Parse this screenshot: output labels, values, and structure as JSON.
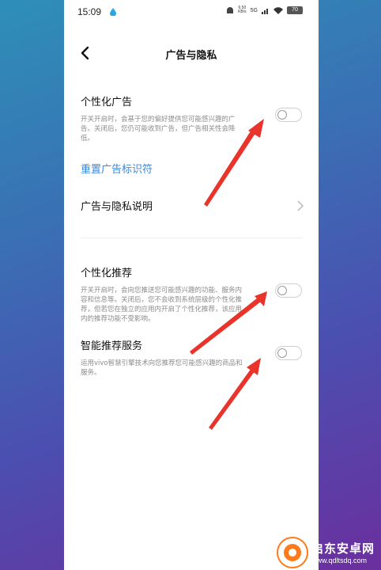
{
  "status_bar": {
    "time": "15:09",
    "net_speed_value": "6.50",
    "net_speed_unit": "KB/s",
    "signal_label": "5G",
    "battery": "70"
  },
  "header": {
    "title": "广告与隐私"
  },
  "settings": [
    {
      "title": "个性化广告",
      "description": "开关开启时，会基于您的偏好提供您可能感兴趣的广告。关闭后，您仍可能收到广告，但广告相关性会降低。",
      "enabled": false
    },
    {
      "title": "个性化推荐",
      "description": "开关开启时，会向您推送您可能感兴趣的功能、服务内容和信息等。关闭后，您不会收到系统层级的个性化推荐，但若您在独立的应用内开启了个性化推荐，该应用内的推荐功能不受影响。",
      "enabled": false
    },
    {
      "title": "智能推荐服务",
      "description": "运用vivo智慧引擎技术向您推荐您可能感兴趣的商品和服务。",
      "enabled": false
    }
  ],
  "reset_link": "重置广告标识符",
  "privacy_row": "广告与隐私说明",
  "watermark": {
    "brand": "启东安卓网",
    "url": "www.qdltsdq.com"
  },
  "colors": {
    "link": "#3b87d9",
    "arrow": "#e8342a",
    "watermark_accent": "#ff7a1a"
  }
}
